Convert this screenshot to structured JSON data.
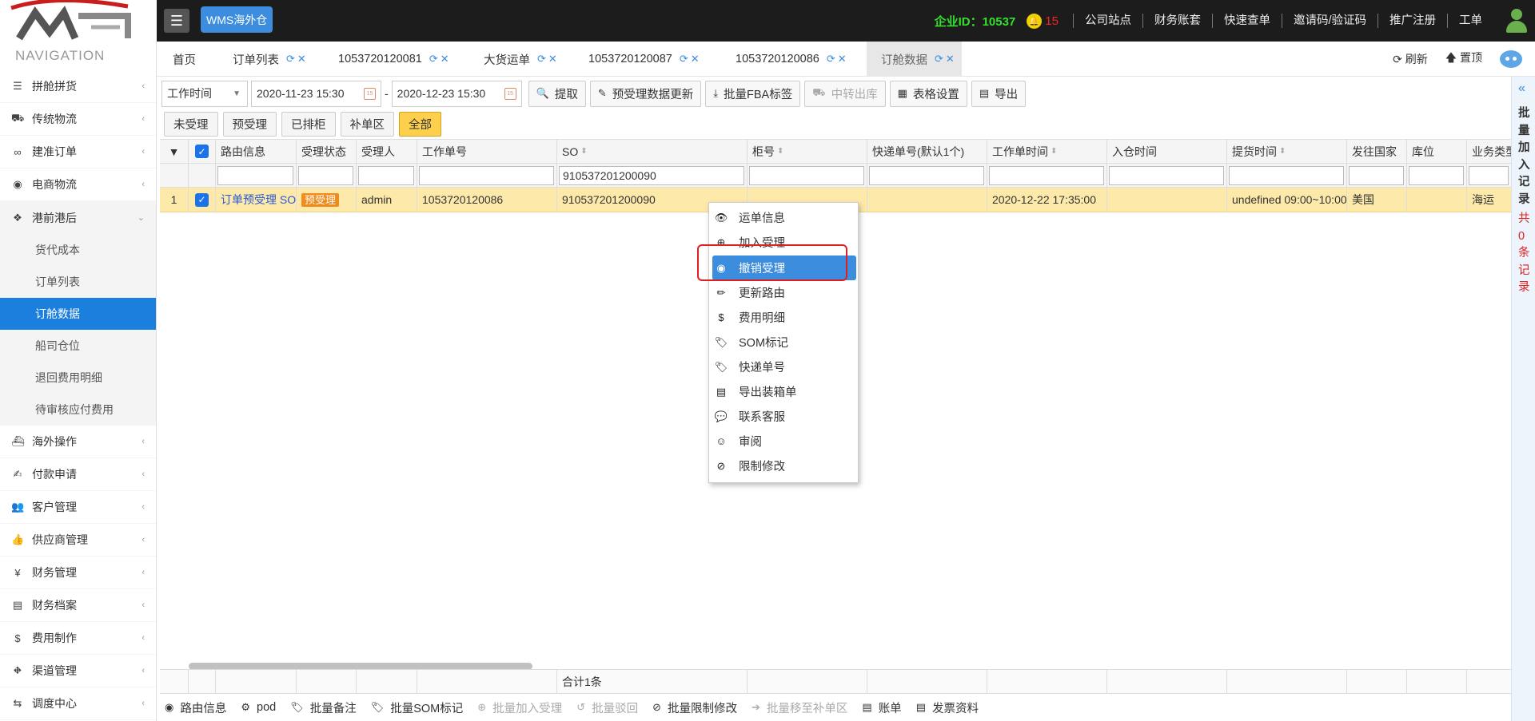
{
  "header": {
    "menu_icon": "bars-icon",
    "brand_button": "WMS海外仓",
    "company_id": "企业ID：10537",
    "notification_count": "15",
    "links": [
      "公司站点",
      "财务账套",
      "快速查单",
      "邀请码/验证码",
      "推广注册",
      "工单"
    ]
  },
  "sidebar": {
    "title": "NAVIGATION",
    "items_top": [
      {
        "label": "拼舱拼货",
        "icon": "list-icon"
      },
      {
        "label": "传统物流",
        "icon": "truck-icon"
      },
      {
        "label": "建准订单",
        "icon": "link-icon"
      },
      {
        "label": "电商物流",
        "icon": "globe-icon"
      }
    ],
    "group": {
      "label": "港前港后",
      "icon": "cubes-icon",
      "children": [
        "货代成本",
        "订单列表",
        "订舱数据",
        "船司仓位",
        "退回费用明细",
        "待审核应付费用"
      ],
      "active_child": "订舱数据"
    },
    "items_bottom": [
      {
        "label": "海外操作",
        "icon": "ship-icon"
      },
      {
        "label": "付款申请",
        "icon": "pay-icon"
      },
      {
        "label": "客户管理",
        "icon": "users-icon"
      },
      {
        "label": "供应商管理",
        "icon": "thumbs-up-icon"
      },
      {
        "label": "财务管理",
        "icon": "yen-icon"
      },
      {
        "label": "财务档案",
        "icon": "book-icon"
      },
      {
        "label": "费用制作",
        "icon": "dollar-icon"
      },
      {
        "label": "渠道管理",
        "icon": "road-icon"
      },
      {
        "label": "调度中心",
        "icon": "exchange-icon"
      }
    ]
  },
  "tabs": [
    {
      "label": "首页",
      "closable": false
    },
    {
      "label": "订单列表",
      "closable": true
    },
    {
      "label": "1053720120081",
      "closable": true
    },
    {
      "label": "大货运单",
      "closable": true
    },
    {
      "label": "1053720120087",
      "closable": true
    },
    {
      "label": "1053720120086",
      "closable": true
    },
    {
      "label": "订舱数据",
      "closable": true,
      "active": true
    }
  ],
  "tab_actions": {
    "refresh": "刷新",
    "top": "置顶"
  },
  "toolbar": {
    "date_field": "工作时间",
    "date_from": "2020-11-23 15:30",
    "date_to": "2020-12-23 15:30",
    "buttons": [
      {
        "label": "提取",
        "icon": "search-icon"
      },
      {
        "label": "预受理数据更新",
        "icon": "edit-icon"
      },
      {
        "label": "批量FBA标签",
        "icon": "download-icon"
      },
      {
        "label": "中转出库",
        "icon": "truck-icon",
        "disabled": true
      },
      {
        "label": "表格设置",
        "icon": "table-icon"
      },
      {
        "label": "导出",
        "icon": "file-icon"
      }
    ]
  },
  "filters": [
    {
      "label": "未受理"
    },
    {
      "label": "预受理"
    },
    {
      "label": "已排柜"
    },
    {
      "label": "补单区"
    },
    {
      "label": "全部",
      "active": true
    }
  ],
  "table": {
    "columns": [
      "路由信息",
      "受理状态",
      "受理人",
      "工作单号",
      "SO",
      "柜号",
      "快递单号(默认1个)",
      "工作单时间",
      "入仓时间",
      "提货时间",
      "发往国家",
      "库位",
      "业务类型"
    ],
    "filter_so": "910537201200090",
    "row": {
      "index": "1",
      "route": "订单预受理 SO",
      "status": "预受理",
      "handler": "admin",
      "work_no": "1053720120086",
      "so": "910537201200090",
      "container": "",
      "express": "",
      "work_time": "2020-12-22 17:35:00",
      "in_time": "",
      "pickup_time": "undefined 09:00~10:00",
      "country": "美国",
      "location": "",
      "biz_type": "海运"
    },
    "total": "合计1条"
  },
  "context_menu": [
    {
      "label": "运单信息",
      "icon": "eye-icon"
    },
    {
      "label": "加入受理",
      "icon": "plus-circle-icon"
    },
    {
      "label": "撤销受理",
      "icon": "stop-circle-icon",
      "active": true
    },
    {
      "label": "更新路由",
      "icon": "pencil-icon"
    },
    {
      "label": "费用明细",
      "icon": "dollar-icon"
    },
    {
      "label": "SOM标记",
      "icon": "tags-icon"
    },
    {
      "label": "快递单号",
      "icon": "tags-icon"
    },
    {
      "label": "导出装箱单",
      "icon": "file-text-icon"
    },
    {
      "label": "联系客服",
      "icon": "comments-icon"
    },
    {
      "label": "审阅",
      "icon": "smile-icon"
    },
    {
      "label": "限制修改",
      "icon": "ban-icon"
    }
  ],
  "bottom_bar": [
    {
      "label": "路由信息",
      "icon": "globe-icon"
    },
    {
      "label": "pod",
      "icon": "gear-icon"
    },
    {
      "label": "批量备注",
      "icon": "tags-icon"
    },
    {
      "label": "批量SOM标记",
      "icon": "tags-icon"
    },
    {
      "label": "批量加入受理",
      "icon": "plus-circle-icon",
      "disabled": true
    },
    {
      "label": "批量驳回",
      "icon": "undo-icon",
      "disabled": true
    },
    {
      "label": "批量限制修改",
      "icon": "ban-icon"
    },
    {
      "label": "批量移至补单区",
      "icon": "arrow-right-icon",
      "disabled": true
    },
    {
      "label": "账单",
      "icon": "file-icon"
    },
    {
      "label": "发票资料",
      "icon": "file-icon"
    }
  ],
  "right_panel": {
    "title": "批量加入记录",
    "count": "共0条记录"
  },
  "colors": {
    "accent": "#3c8dde",
    "active_nav": "#1b7fde",
    "row_highlight": "#fde9a9",
    "status_badge": "#f08c1c",
    "company_id": "#35e02d",
    "highlight_box": "#e02020"
  }
}
